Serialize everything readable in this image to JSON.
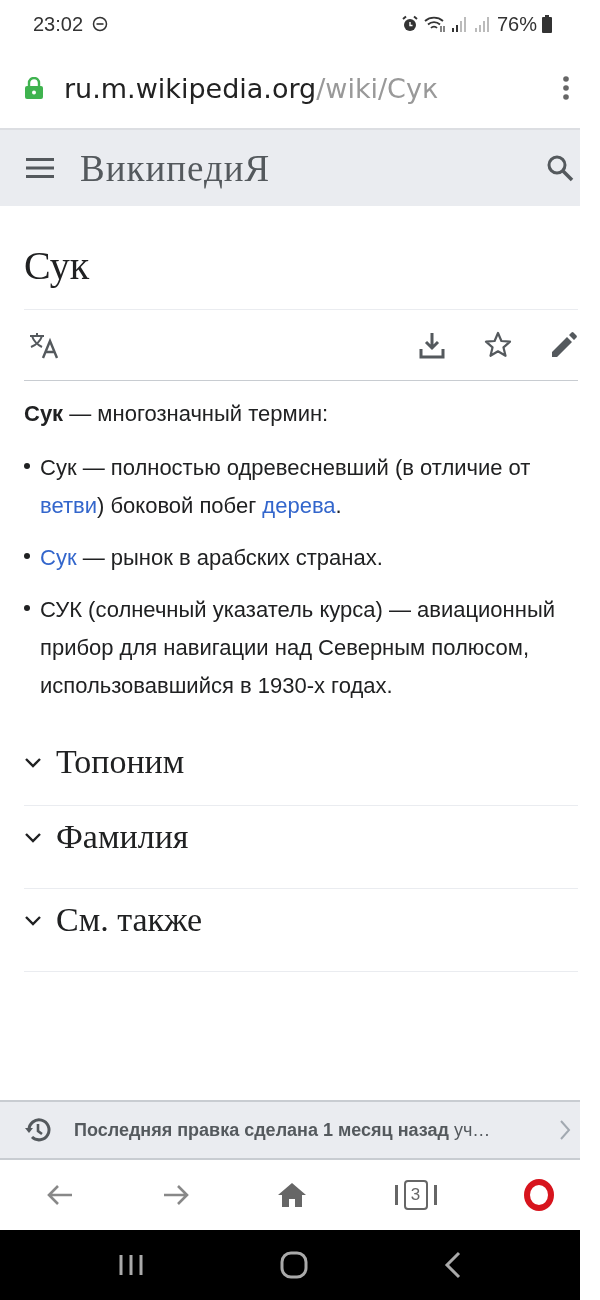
{
  "status_bar": {
    "time": "23:02",
    "battery": "76%"
  },
  "address_bar": {
    "host": "ru.m.wikipedia.org",
    "path": "/wiki/Сук",
    "secure": true
  },
  "site_header": {
    "logo": "ВикипедиЯ"
  },
  "page": {
    "title": "Сук",
    "intro": [
      {
        "text": "Сук",
        "bold": true
      },
      {
        "text": " — многозначный термин:",
        "bold": false
      }
    ],
    "items": [
      [
        {
          "text": "Сук — полностью одревесневший (в отличие от ",
          "link": false
        },
        {
          "text": "ветви",
          "link": true
        },
        {
          "text": ") боковой побег ",
          "link": false
        },
        {
          "text": "дерева",
          "link": true
        },
        {
          "text": ".",
          "link": false
        }
      ],
      [
        {
          "text": "Сук",
          "link": true
        },
        {
          "text": " — рынок в арабских странах.",
          "link": false
        }
      ],
      [
        {
          "text": "СУК (солнечный указатель курса) — авиационный прибор для навигации над Северным полюсом, использовавшийся в 1930-х годах.",
          "link": false
        }
      ]
    ],
    "sections": [
      {
        "title": "Топоним",
        "expanded": false
      },
      {
        "title": "Фамилия",
        "expanded": false
      },
      {
        "title": "См. также",
        "expanded": false
      }
    ]
  },
  "last_edit": {
    "text": "**Последняя правка сделана 1 месяц назад** уч…"
  },
  "toolbar": {
    "tab_count": "3"
  }
}
